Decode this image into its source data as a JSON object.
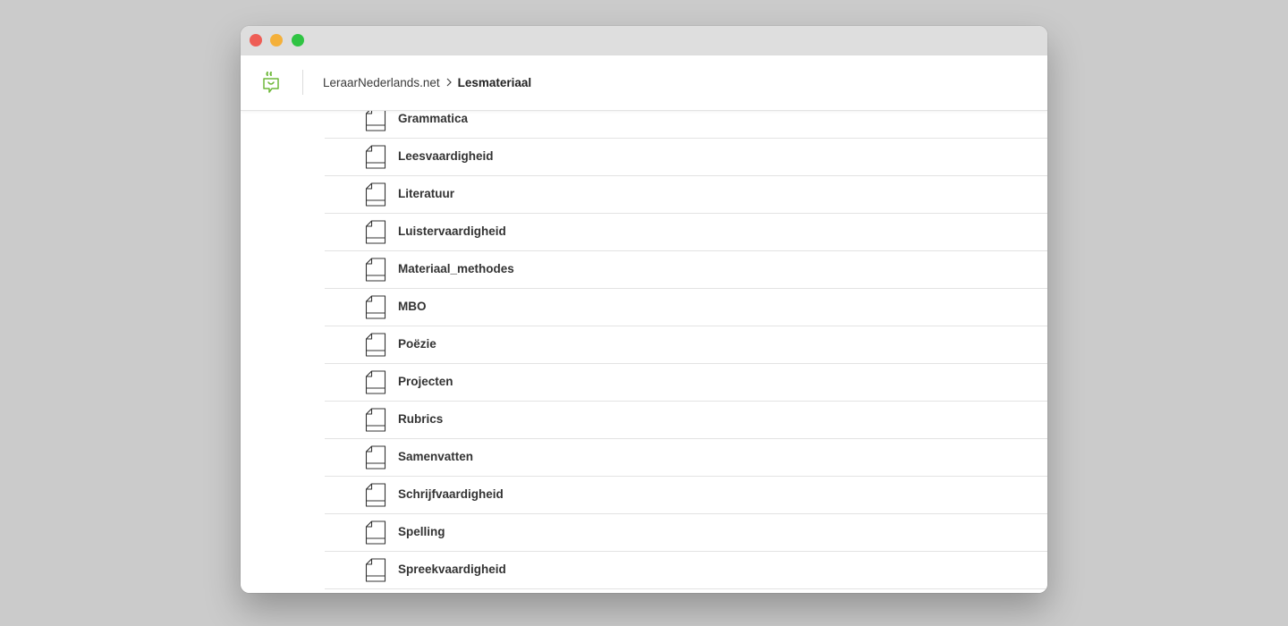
{
  "colors": {
    "close": "#ee5d55",
    "minimize": "#f4b03a",
    "zoom": "#2fc443",
    "brand_green": "#6fb93a"
  },
  "header": {
    "logo_icon": "speech-bubble-smiley-icon",
    "breadcrumb": {
      "site": "LeraarNederlands.net",
      "separator_icon": "chevron-right-icon",
      "current": "Lesmateriaal"
    }
  },
  "folders": [
    {
      "label": "Grammatica",
      "icon": "document-icon"
    },
    {
      "label": "Leesvaardigheid",
      "icon": "document-icon"
    },
    {
      "label": "Literatuur",
      "icon": "document-icon"
    },
    {
      "label": "Luistervaardigheid",
      "icon": "document-icon"
    },
    {
      "label": "Materiaal_methodes",
      "icon": "document-icon"
    },
    {
      "label": "MBO",
      "icon": "document-icon"
    },
    {
      "label": "Poëzie",
      "icon": "document-icon"
    },
    {
      "label": "Projecten",
      "icon": "document-icon"
    },
    {
      "label": "Rubrics",
      "icon": "document-icon"
    },
    {
      "label": "Samenvatten",
      "icon": "document-icon"
    },
    {
      "label": "Schrijfvaardigheid",
      "icon": "document-icon"
    },
    {
      "label": "Spelling",
      "icon": "document-icon"
    },
    {
      "label": "Spreekvaardigheid",
      "icon": "document-icon"
    }
  ]
}
